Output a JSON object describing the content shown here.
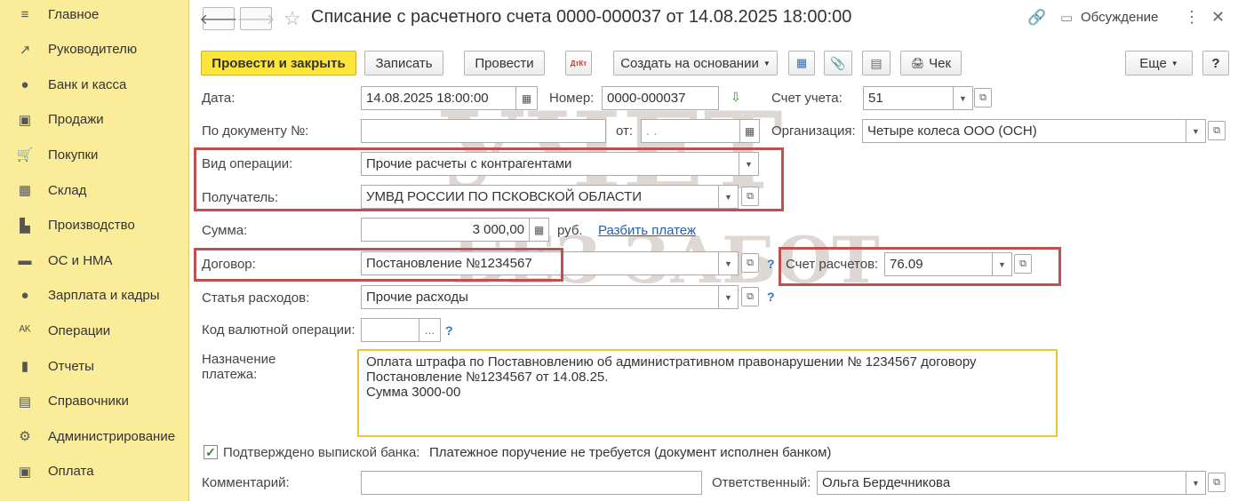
{
  "sidebar": {
    "items": [
      {
        "label": "Главное",
        "icon": "menu-icon",
        "glyph": "≡"
      },
      {
        "label": "Руководителю",
        "icon": "trend-icon",
        "glyph": "↗"
      },
      {
        "label": "Банк и касса",
        "icon": "coin-icon",
        "glyph": "●"
      },
      {
        "label": "Продажи",
        "icon": "bag-icon",
        "glyph": "▣"
      },
      {
        "label": "Покупки",
        "icon": "cart-icon",
        "glyph": "🛒"
      },
      {
        "label": "Склад",
        "icon": "warehouse-icon",
        "glyph": "▦"
      },
      {
        "label": "Производство",
        "icon": "factory-icon",
        "glyph": "▙"
      },
      {
        "label": "ОС и НМА",
        "icon": "truck-icon",
        "glyph": "▬"
      },
      {
        "label": "Зарплата и кадры",
        "icon": "person-icon",
        "glyph": "●"
      },
      {
        "label": "Операции",
        "icon": "dt-kt-icon",
        "glyph": "ᴬᴷ"
      },
      {
        "label": "Отчеты",
        "icon": "bar-chart-icon",
        "glyph": "▮"
      },
      {
        "label": "Справочники",
        "icon": "book-icon",
        "glyph": "▤"
      },
      {
        "label": "Администрирование",
        "icon": "gear-icon",
        "glyph": "⚙"
      },
      {
        "label": "Оплата",
        "icon": "wallet-icon",
        "glyph": "▣"
      }
    ]
  },
  "header": {
    "title": "Списание с расчетного счета 0000-000037 от 14.08.2025 18:00:00",
    "discussion_label": "Обсуждение"
  },
  "toolbar": {
    "post_close": "Провести и закрыть",
    "save": "Записать",
    "post": "Провести",
    "dtkt": "ДтКт",
    "create_based": "Создать на основании",
    "check": "Чек",
    "more": "Еще",
    "help": "?"
  },
  "form": {
    "date_label": "Дата:",
    "date_value": "14.08.2025 18:00:00",
    "number_label": "Номер:",
    "number_value": "0000-000037",
    "account_label": "Счет учета:",
    "account_value": "51",
    "doc_no_label": "По документу №:",
    "doc_no_value": "",
    "from_label": "от:",
    "from_value": " .  . ",
    "org_label": "Организация:",
    "org_value": "Четыре колеса ООО (ОСН)",
    "op_type_label": "Вид операции:",
    "op_type_value": "Прочие расчеты с контрагентами",
    "recipient_label": "Получатель:",
    "recipient_value": "УМВД РОССИИ ПО ПСКОВСКОЙ ОБЛАСТИ",
    "sum_label": "Сумма:",
    "sum_value": "3 000,00",
    "currency": "руб.",
    "split_link": "Разбить платеж",
    "contract_label": "Договор:",
    "contract_value": "Постановление №1234567",
    "settle_account_label": "Счет расчетов:",
    "settle_account_value": "76.09",
    "expense_label": "Статья расходов:",
    "expense_value": "Прочие расходы",
    "currency_op_label": "Код валютной операции:",
    "currency_op_value": "",
    "purpose_label_1": "Назначение",
    "purpose_label_2": "платежа:",
    "purpose_line1": "Оплата штрафа по Поставновлению об административном правонарушении № 1234567 договору",
    "purpose_line2": "Постановление №1234567 от 14.08.25.",
    "purpose_line3": "Сумма 3000-00",
    "confirmed_label": "Подтверждено выпиской банка:",
    "confirmed_checked": true,
    "payment_order_text": "Платежное поручение не требуется (документ исполнен банком)",
    "comment_label": "Комментарий:",
    "comment_value": "",
    "responsible_label": "Ответственный:",
    "responsible_value": "Ольга Бердечникова"
  },
  "watermark": {
    "line1": "УЧЕТ",
    "line2": "БЕЗ ЗАБОТ"
  },
  "colors": {
    "sidebar_bg": "#fbec9a",
    "primary_button": "#fde53c",
    "highlight_red": "#c0504d",
    "highlight_yellow": "#f0c530",
    "link": "#1f61b5"
  }
}
